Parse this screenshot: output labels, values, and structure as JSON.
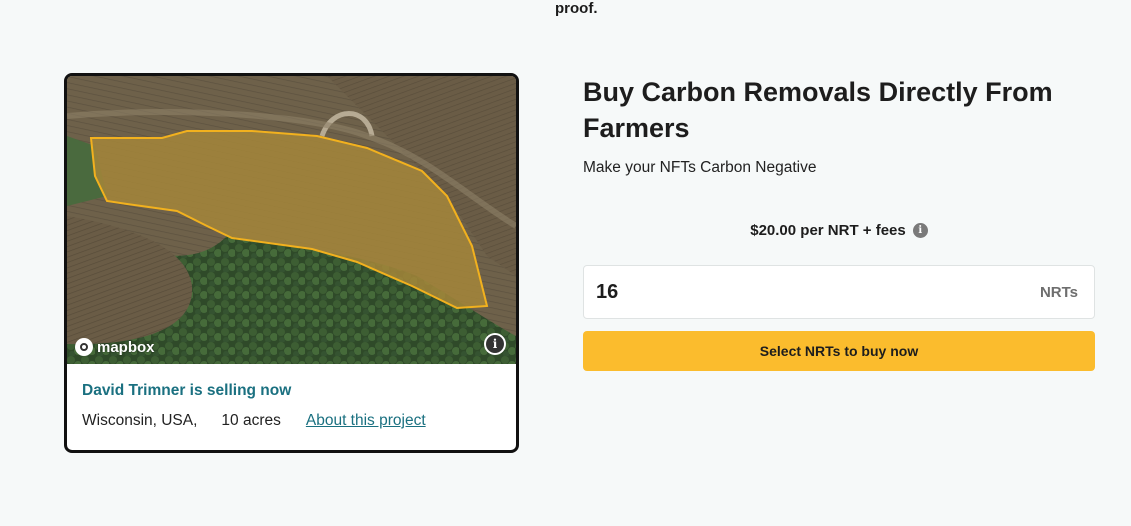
{
  "page": {
    "top_fragment": "proof."
  },
  "project_card": {
    "map_attribution": "mapbox",
    "seller_text": "David Trimner is selling now",
    "location": "Wisconsin, USA,",
    "acreage": "10 acres",
    "about_link": "About this project"
  },
  "purchase": {
    "title": "Buy Carbon Removals Directly From Farmers",
    "subtitle": "Make your NFTs Carbon Negative",
    "price": "$20.00 per NRT + fees",
    "quantity": "16",
    "unit": "NRTs",
    "buy_button": "Select NRTs to buy now"
  },
  "icons": {
    "info": "info-icon",
    "map_info": "map-info-icon",
    "mapbox_logo": "mapbox-logo-icon"
  },
  "colors": {
    "accent_teal": "#1a7080",
    "button_yellow": "#fbbc2d",
    "field_outline": "#f2b11e"
  }
}
